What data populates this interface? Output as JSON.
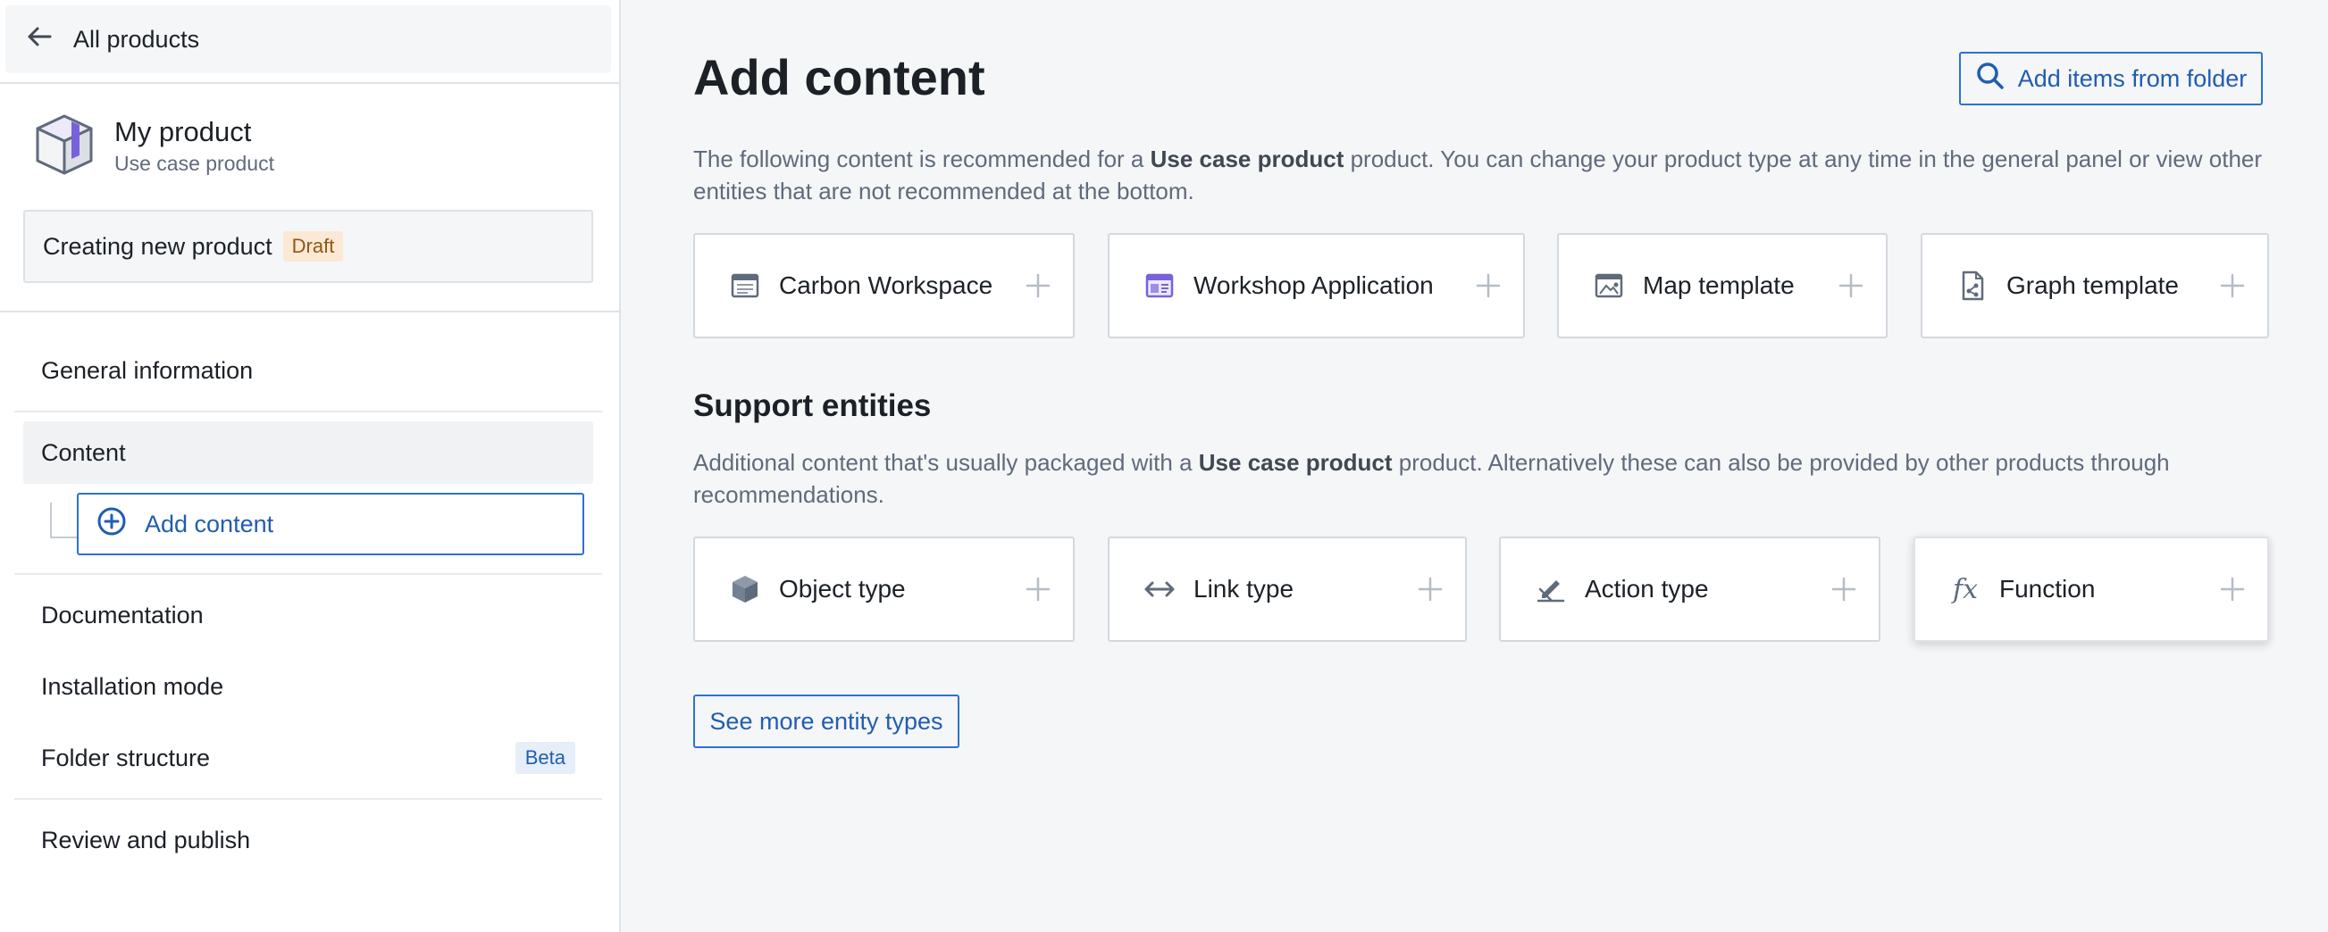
{
  "sidebar": {
    "back_label": "All products",
    "product": {
      "name": "My product",
      "type": "Use case product"
    },
    "status": {
      "text": "Creating new product",
      "tag": "Draft"
    },
    "nav": {
      "general": "General information",
      "content": "Content",
      "add_content": "Add content",
      "documentation": "Documentation",
      "installation": "Installation mode",
      "folder": "Folder structure",
      "folder_tag": "Beta",
      "review": "Review and publish"
    }
  },
  "main": {
    "title": "Add content",
    "add_from_folder": "Add items from folder",
    "intro": {
      "p1": "The following content is recommended for a ",
      "bold": "Use case product",
      "p2": " product. You can change your product type at any time in the general panel or view other entities that are not recommended at the bottom."
    },
    "recommended": [
      {
        "label": "Carbon Workspace",
        "icon": "carbon-workspace-icon"
      },
      {
        "label": "Workshop Application",
        "icon": "workshop-application-icon"
      },
      {
        "label": "Map template",
        "icon": "map-template-icon"
      },
      {
        "label": "Graph template",
        "icon": "graph-template-icon"
      }
    ],
    "support": {
      "title": "Support entities",
      "p1": "Additional content that's usually packaged with a ",
      "bold": "Use case product",
      "p2": " product. Alternatively these can also be provided by other products through recommendations.",
      "items": [
        {
          "label": "Object type",
          "icon": "cube-icon"
        },
        {
          "label": "Link type",
          "icon": "arrows-horizontal-icon"
        },
        {
          "label": "Action type",
          "icon": "action-edit-icon"
        },
        {
          "label": "Function",
          "icon": "function-fx-icon",
          "glyph": "fx"
        }
      ]
    },
    "more_button": "See more entity types"
  },
  "colors": {
    "accent": "#2d72d2",
    "accent_text": "#215db0",
    "draft_bg": "#fbe9d6",
    "draft_text": "#935610",
    "beta_bg": "#e6eef8",
    "muted_text": "#5f6b7c"
  }
}
